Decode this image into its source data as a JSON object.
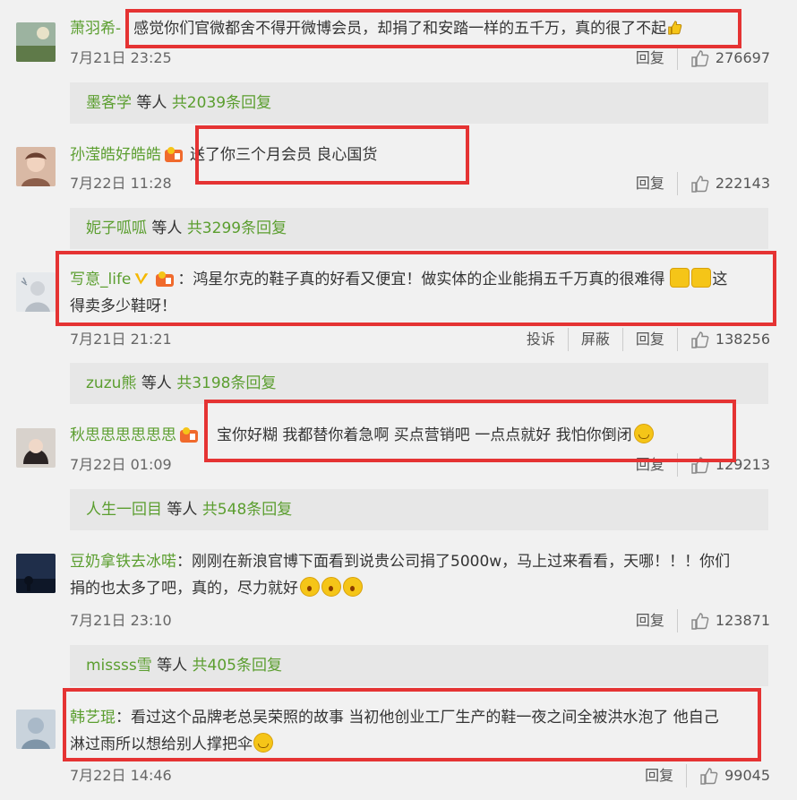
{
  "comments": [
    {
      "user": "萧羽希-",
      "text": "感觉你们官微都舍不得开微博会员，却捐了和安踏一样的五千万，真的很了不起",
      "time": "7月21日 23:25",
      "reply_label": "回复",
      "likes": "276697",
      "thread": {
        "name": "墨客学",
        "others": "等人",
        "count": "共2039条回复"
      }
    },
    {
      "user": "孙滢皓好皓皓",
      "text": "送了你三个月会员 良心国货",
      "time": "7月22日 11:28",
      "reply_label": "回复",
      "likes": "222143",
      "thread": {
        "name": "妮子呱呱",
        "others": "等人",
        "count": "共3299条回复"
      }
    },
    {
      "user": "写意_life",
      "text1": "：鸿星尔克的鞋子真的好看又便宜！做实体的企业能捐五千万真的很难得",
      "text2": "这",
      "text3": "得卖多少鞋呀！",
      "time": "7月21日 21:21",
      "report_label": "投诉",
      "block_label": "屏蔽",
      "reply_label": "回复",
      "likes": "138256",
      "thread": {
        "name": "zuzu熊",
        "others": "等人",
        "count": "共3198条回复"
      }
    },
    {
      "user": "秋思思思思思思",
      "text": "：宝你好糊 我都替你着急啊 买点营销吧 一点点就好 我怕你倒闭",
      "time": "7月22日 01:09",
      "reply_label": "回复",
      "likes": "129213",
      "thread": {
        "name": "人生一回目",
        "others": "等人",
        "count": "共548条回复"
      }
    },
    {
      "user": "豆奶拿铁去冰喏",
      "text1": "：刚刚在新浪官博下面看到说贵公司捐了5000w，马上过来看看，天哪！！！你们",
      "text2": "捐的也太多了吧，真的，尽力就好",
      "time": "7月21日 23:10",
      "reply_label": "回复",
      "likes": "123871",
      "thread": {
        "name": "missss雪",
        "others": "等人",
        "count": "共405条回复"
      }
    },
    {
      "user": "韩艺琨",
      "text1": "：看过这个品牌老总吴荣照的故事 当初他创业工厂生产的鞋一夜之间全被洪水泡了 他自己",
      "text2": "淋过雨所以想给别人撑把伞",
      "time": "7月22日 14:46",
      "reply_label": "回复",
      "likes": "99045"
    }
  ]
}
